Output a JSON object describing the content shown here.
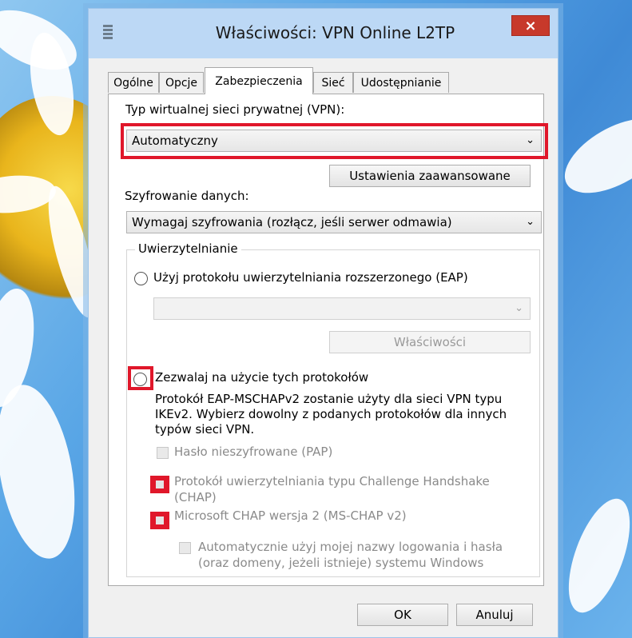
{
  "window": {
    "title": "Właściwości: VPN Online L2TP",
    "close_icon": "×"
  },
  "tabs": [
    {
      "label": "Ogólne",
      "active": false
    },
    {
      "label": "Opcje",
      "active": false
    },
    {
      "label": "Zabezpieczenia",
      "active": true
    },
    {
      "label": "Sieć",
      "active": false
    },
    {
      "label": "Udostępnianie",
      "active": false
    }
  ],
  "security": {
    "vpn_type_label": "Typ wirtualnej sieci prywatnej (VPN):",
    "vpn_type_value": "Automatyczny",
    "advanced_button": "Ustawienia zaawansowane",
    "encryption_label": "Szyfrowanie danych:",
    "encryption_value": "Wymagaj szyfrowania (rozłącz, jeśli serwer odmawia)",
    "auth_legend": "Uwierzytelnianie",
    "eap_radio_label": "Użyj protokołu uwierzytelniania rozszerzonego (EAP)",
    "eap_combo_value": "",
    "eap_properties_button": "Właściwości",
    "allow_protocols_label": "Zezwalaj na użycie tych protokołów",
    "allow_protocols_note": "Protokół EAP-MSCHAPv2 zostanie użyty dla sieci VPN typu IKEv2. Wybierz dowolny z podanych protokołów dla innych typów sieci VPN.",
    "protocols": [
      {
        "label": "Hasło nieszyfrowane (PAP)"
      },
      {
        "label": "Protokół uwierzytelniania typu Challenge Handshake (CHAP)"
      },
      {
        "label": "Microsoft CHAP wersja 2 (MS-CHAP v2)"
      }
    ],
    "auto_windows_logon": "Automatycznie użyj mojej nazwy logowania i hasła (oraz domeny, jeżeli istnieje) systemu Windows"
  },
  "footer": {
    "ok_button": "OK",
    "cancel_button": "Anuluj"
  },
  "colors": {
    "highlight": "#e0172a",
    "titlebar": "#bcd8f5",
    "close_button": "#c7392b"
  },
  "icons": {
    "chevron": "⌄"
  }
}
